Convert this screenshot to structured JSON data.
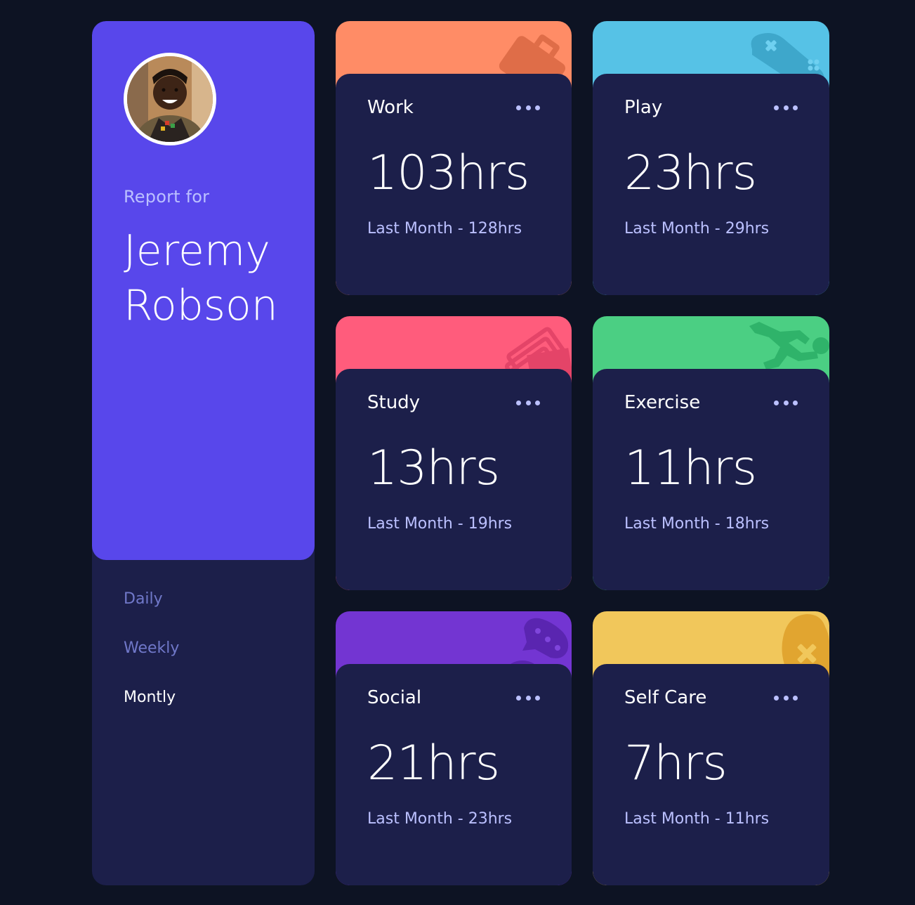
{
  "profile": {
    "report_label": "Report for",
    "name": "Jeremy Robson",
    "avatar_alt": "Jeremy Robson avatar"
  },
  "periods": [
    {
      "label": "Daily",
      "active": false
    },
    {
      "label": "Weekly",
      "active": false
    },
    {
      "label": "Montly",
      "active": true
    }
  ],
  "activities": [
    {
      "title": "Work",
      "current": "103hrs",
      "previous": "Last Month - 128hrs",
      "color": "#ff8c66",
      "icon": "briefcase-icon"
    },
    {
      "title": "Play",
      "current": "23hrs",
      "previous": "Last Month - 29hrs",
      "color": "#56c2e6",
      "icon": "gamepad-icon"
    },
    {
      "title": "Study",
      "current": "13hrs",
      "previous": "Last Month - 19hrs",
      "color": "#ff5c7c",
      "icon": "books-icon"
    },
    {
      "title": "Exercise",
      "current": "11hrs",
      "previous": "Last Month - 18hrs",
      "color": "#4bcf83",
      "icon": "running-icon"
    },
    {
      "title": "Social",
      "current": "21hrs",
      "previous": "Last Month - 23hrs",
      "color": "#7335d2",
      "icon": "chat-bubble-icon"
    },
    {
      "title": "Self Care",
      "current": "7hrs",
      "previous": "Last Month - 11hrs",
      "color": "#f1c75b",
      "icon": "heart-icon"
    }
  ],
  "colors": {
    "background": "#0d1323",
    "card": "#1c1f4a",
    "accent": "#5847eb",
    "muted": "#bbc0ff",
    "inactive_period": "#7078c9"
  }
}
